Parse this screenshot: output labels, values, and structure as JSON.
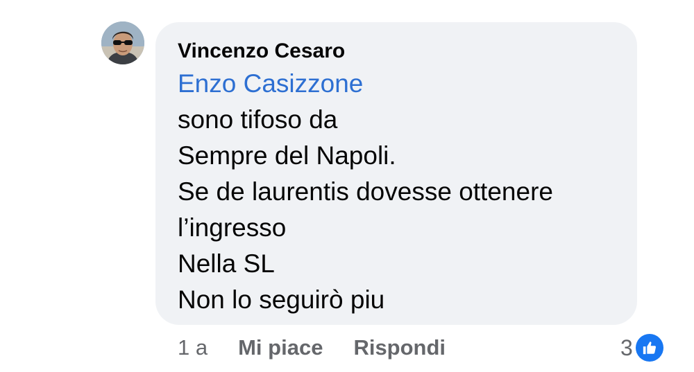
{
  "comment": {
    "author": "Vincenzo Cesaro",
    "mention": "Enzo Casizzone",
    "lines": [
      "sono tifoso da",
      "Sempre del Napoli.",
      "Se de laurentis dovesse ottenere",
      "l’ingresso",
      "Nella SL",
      "Non lo seguirò piu"
    ]
  },
  "actions": {
    "time": "1 a",
    "like_label": "Mi piace",
    "reply_label": "Rispondi"
  },
  "reactions": {
    "count": "3",
    "icon": "thumbs-up-icon",
    "badge_color": "#1877f2"
  },
  "colors": {
    "bubble": "#f0f2f5",
    "mention": "#2d6fd2",
    "meta_text": "#65676b"
  }
}
